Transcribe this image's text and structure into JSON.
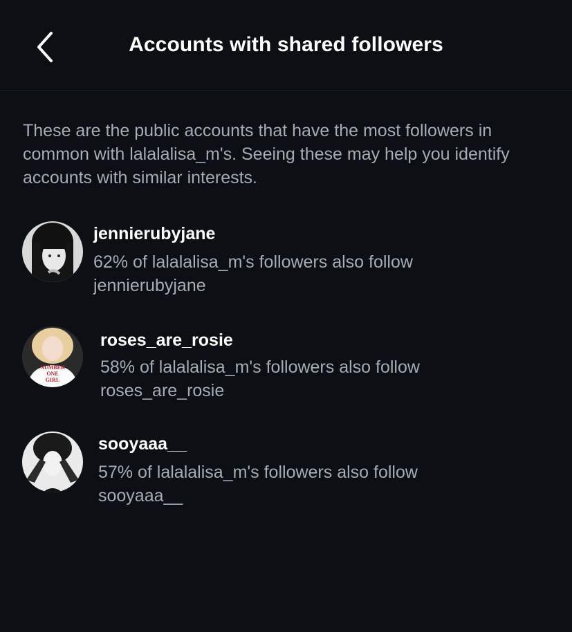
{
  "header": {
    "title": "Accounts with shared followers",
    "back_icon": "chevron-left-icon"
  },
  "intro_text": "These are the public accounts that have the most followers in common with lalalalisa_m's. Seeing these may help you identify accounts with similar interests.",
  "accounts": [
    {
      "username": "jennierubyjane",
      "line1": "62% of lalalalisa_m's followers also follow",
      "line2": "jennierubyjane"
    },
    {
      "username": "roses_are_rosie",
      "line1": "58% of lalalalisa_m's followers also follow",
      "line2": "roses_are_rosie",
      "shirt_text": [
        "NUMBER",
        "ONE",
        "GIRL"
      ]
    },
    {
      "username": "sooyaaa__",
      "line1": "57% of lalalalisa_m's followers also follow",
      "line2": "sooyaaa__"
    }
  ],
  "colors": {
    "background": "#0c0f14",
    "primary_text": "#ffffff",
    "secondary_text": "#a7abb3",
    "divider": "#22262d"
  }
}
